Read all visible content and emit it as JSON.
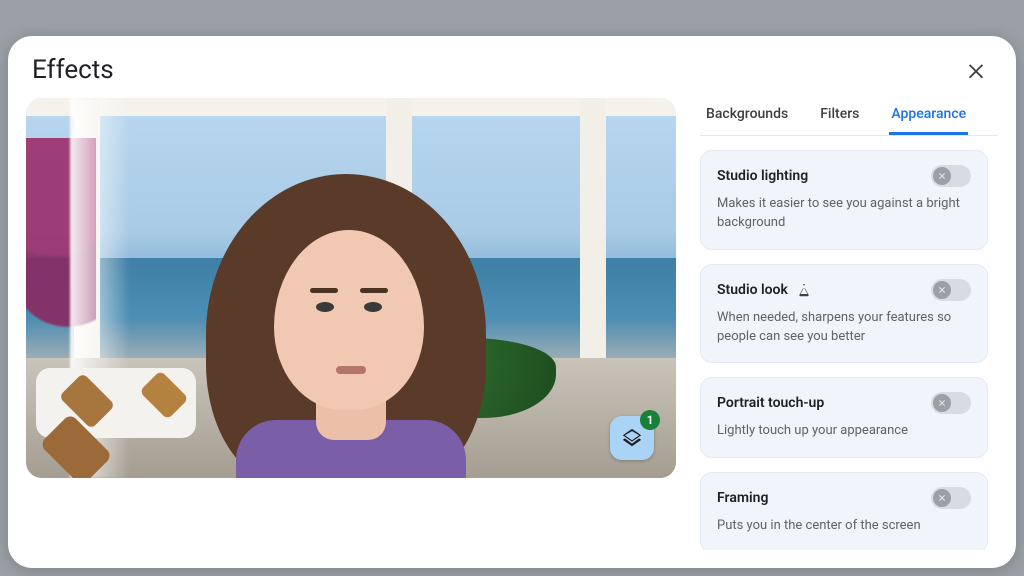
{
  "header": {
    "title": "Effects",
    "close_icon": "close-icon"
  },
  "preview": {
    "layers_icon": "layers-icon",
    "layers_badge_count": "1"
  },
  "tabs": [
    {
      "label": "Backgrounds",
      "active": false
    },
    {
      "label": "Filters",
      "active": false
    },
    {
      "label": "Appearance",
      "active": true
    }
  ],
  "appearance_options": [
    {
      "title": "Studio lighting",
      "description": "Makes it easier to see you against a bright background",
      "experimental": false,
      "enabled": false
    },
    {
      "title": "Studio look",
      "description": "When needed, sharpens your features so people can see you better",
      "experimental": true,
      "enabled": false
    },
    {
      "title": "Portrait touch-up",
      "description": "Lightly touch up your appearance",
      "experimental": false,
      "enabled": false
    },
    {
      "title": "Framing",
      "description": "Puts you in the center of the screen",
      "experimental": false,
      "enabled": false
    }
  ],
  "colors": {
    "accent": "#1a73e8",
    "badge": "#188038"
  }
}
